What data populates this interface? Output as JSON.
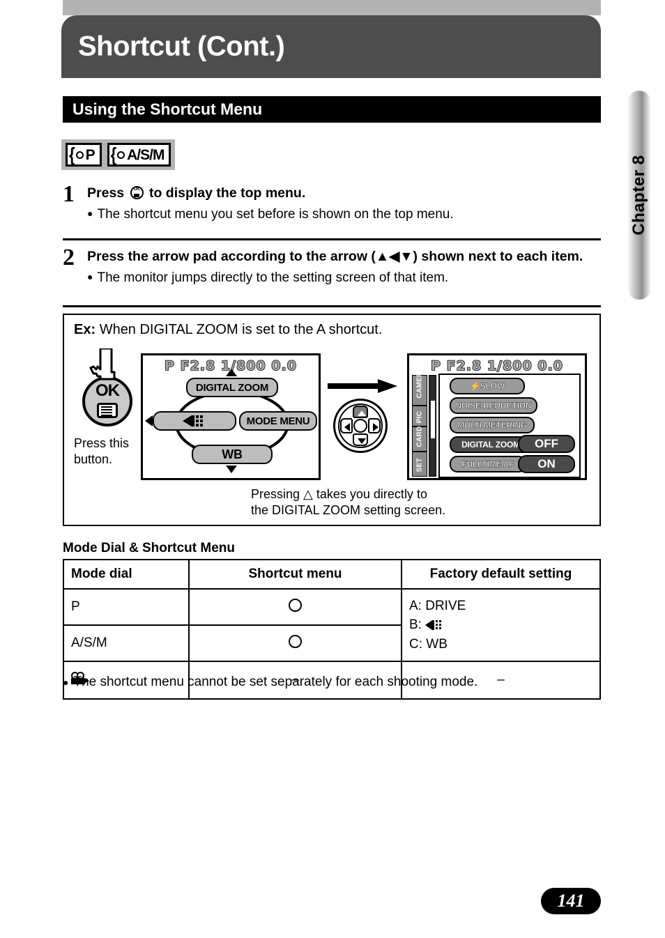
{
  "header": {
    "title": "Shortcut (Cont.)",
    "section_heading": "Using the Shortcut Menu",
    "chapter_tab": "Chapter 8",
    "bar_color": "#4d4d4d",
    "strip_color": "#b3b3b3"
  },
  "mode_badges": [
    {
      "name": "mode-badge-p",
      "label": "P"
    },
    {
      "name": "mode-badge-asm",
      "label": "A/S/M"
    }
  ],
  "steps": [
    {
      "number": "1",
      "title_before": "Press",
      "title_after": "to display the top menu.",
      "icon": "ok-menu-button-icon",
      "bullet": "The shortcut menu you set before is shown on the top menu."
    },
    {
      "number": "2",
      "title": "Press the arrow pad according to the arrow (▲◀▼) shown next to each item.",
      "bullet": "The monitor jumps directly to the setting screen of that item."
    }
  ],
  "example": {
    "label": "Ex:",
    "caption": "When DIGITAL ZOOM is set to the A shortcut.",
    "press_button_note": "Press this\nbutton.",
    "press_button_line1": "Press this",
    "press_button_line2": "button.",
    "ok_button_label": "OK",
    "lcd_status": "P F2.8 1/800   0.0",
    "top_menu": {
      "top": "DIGITAL ZOOM",
      "left_icon": "drive-icon",
      "right": "MODE MENU",
      "bottom": "WB"
    },
    "mode_menu": {
      "side_tabs": [
        "CAMERA",
        "PIC",
        "CARD",
        "SET"
      ],
      "items": [
        {
          "label": "⚡SLOW",
          "selected": false
        },
        {
          "label": "NOISE REDUCTION",
          "selected": false
        },
        {
          "label": "MULTI METERING",
          "selected": false
        },
        {
          "label": "DIGITAL ZOOM",
          "selected": true
        },
        {
          "label": "FULLTIME AF",
          "selected": false
        }
      ],
      "values": [
        "OFF",
        "ON"
      ]
    },
    "note_line1": "Pressing △ takes you directly to",
    "note_line2": "the DIGITAL ZOOM setting screen."
  },
  "table": {
    "title": "Mode Dial & Shortcut Menu",
    "columns": [
      "Mode dial",
      "Shortcut menu",
      "Factory default setting"
    ],
    "rows": [
      {
        "mode": "P",
        "shortcut": "○",
        "default": ""
      },
      {
        "mode": "A/S/M",
        "shortcut": "○",
        "default": ""
      },
      {
        "mode": "movie-icon",
        "shortcut": "–",
        "default": "–"
      }
    ],
    "defaults": {
      "a": "A: DRIVE",
      "b_prefix": "B:",
      "c": "C: WB"
    }
  },
  "footnote": "The shortcut menu cannot be set separately for each shooting mode.",
  "page_number": "141"
}
